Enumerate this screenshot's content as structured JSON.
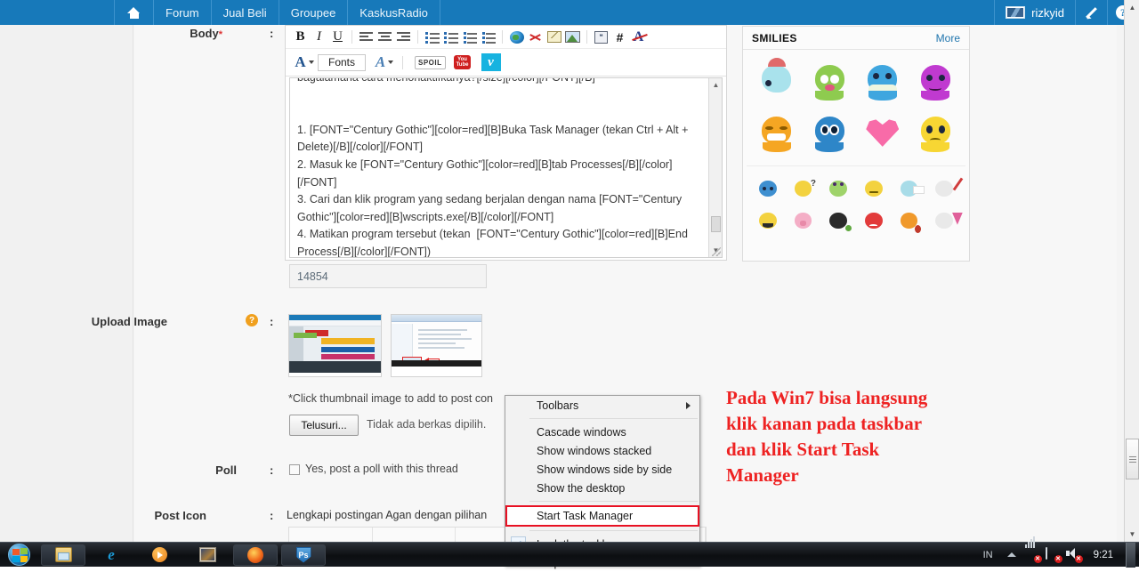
{
  "topnav": {
    "home_icon": "home-icon",
    "items": [
      {
        "label": "Forum"
      },
      {
        "label": "Jual Beli"
      },
      {
        "label": "Groupee"
      },
      {
        "label": "KaskusRadio"
      }
    ],
    "username": "rizkyid",
    "compose_icon": "pencil-icon",
    "help_icon": "question-mark-icon"
  },
  "form": {
    "body_label": "Body",
    "body_required": "*",
    "colon": ":",
    "upload_label": "Upload Image",
    "poll_label": "Poll",
    "posticon_label": "Post Icon",
    "help_badge": "?"
  },
  "editor": {
    "toolbar_row1": [
      {
        "name": "bold-icon",
        "glyph": "B"
      },
      {
        "name": "italic-icon",
        "glyph": "I"
      },
      {
        "name": "underline-icon",
        "glyph": "U"
      },
      {
        "name": "align-left-icon",
        "glyph": ""
      },
      {
        "name": "align-center-icon",
        "glyph": ""
      },
      {
        "name": "align-right-icon",
        "glyph": ""
      },
      {
        "name": "bullet-list-icon",
        "glyph": ""
      },
      {
        "name": "numbered-list-icon",
        "glyph": ""
      },
      {
        "name": "indent-icon",
        "glyph": ""
      },
      {
        "name": "outdent-icon",
        "glyph": ""
      },
      {
        "name": "insert-link-icon",
        "glyph": ""
      },
      {
        "name": "remove-link-icon",
        "glyph": ""
      },
      {
        "name": "insert-email-icon",
        "glyph": ""
      },
      {
        "name": "insert-image-icon",
        "glyph": ""
      },
      {
        "name": "quote-icon",
        "glyph": ""
      },
      {
        "name": "hash-icon",
        "glyph": "#"
      },
      {
        "name": "strike-format-icon",
        "glyph": ""
      }
    ],
    "font_color_icon": "font-color-icon",
    "fonts_label": "Fonts",
    "font_size_icon": "font-size-icon",
    "spoiler_label": "SPOIL",
    "youtube_label_top": "You",
    "youtube_label_bottom": "Tube",
    "vimeo_glyph": "v",
    "body_text": "bagaiamana cara menonaktifkanya?[/size][/color][/FONT][/B]\n\n\n1. [FONT=\"Century Gothic\"][color=red][B]Buka Task Manager (tekan Ctrl + Alt + Delete)[/B][/color][/FONT]\n2. Masuk ke [FONT=\"Century Gothic\"][color=red][B]tab Processes[/B][/color][/FONT]\n3. Cari dan klik program yang sedang berjalan dengan nama [FONT=\"Century Gothic\"][color=red][B]wscripts.exe[/B][/color][/FONT]\n4. Matikan program tersebut (tekan  [FONT=\"Century Gothic\"][color=red][B]End Process[/B][/color][/FONT])",
    "char_counter": "14854"
  },
  "upload": {
    "hint": "*Click thumbnail image to add to post con",
    "browse_button": "Telusuri...",
    "no_file_text": "Tidak ada berkas dipilih.",
    "thumbnails": [
      "forum-page-thumbnail",
      "task-manager-thumbnail"
    ]
  },
  "poll": {
    "checkbox_label": "Yes, post a poll with this thread",
    "checked": false
  },
  "posticon": {
    "text": "Lengkapi postingan Agan dengan pilihan"
  },
  "smilies": {
    "title": "SMILIES",
    "more_label": "More",
    "row1": [
      "whale-smiley",
      "green-monster-smiley",
      "blue-octopus-smiley",
      "purple-blob-smiley"
    ],
    "row2": [
      "orange-grin-smiley",
      "blue-teary-smiley",
      "pink-heart-smiley",
      "yellow-sad-smiley"
    ],
    "row3": [
      "blue-drink-smiley",
      "yellow-confused-smiley",
      "green-frog-smiley",
      "yellow-smirk-smiley",
      "blue-tissue-smiley",
      "white-pen-smiley"
    ],
    "row4": [
      "yellow-mustache-smiley",
      "pink-pig-smiley",
      "black-bomb-smiley",
      "red-angry-smiley",
      "orange-sick-smiley",
      "white-flower-smiley"
    ]
  },
  "context_menu": {
    "items": [
      {
        "label": "Toolbars",
        "submenu": true,
        "checked": false,
        "highlighted": false
      },
      {
        "label": "Cascade windows",
        "submenu": false,
        "checked": false,
        "highlighted": false
      },
      {
        "label": "Show windows stacked",
        "submenu": false,
        "checked": false,
        "highlighted": false
      },
      {
        "label": "Show windows side by side",
        "submenu": false,
        "checked": false,
        "highlighted": false
      },
      {
        "label": "Show the desktop",
        "submenu": false,
        "checked": false,
        "highlighted": false
      },
      {
        "label": "Start Task Manager",
        "submenu": false,
        "checked": false,
        "highlighted": true
      },
      {
        "label": "Lock the taskbar",
        "submenu": false,
        "checked": true,
        "highlighted": false
      },
      {
        "label": "Properties",
        "submenu": false,
        "checked": false,
        "highlighted": false
      }
    ],
    "check_glyph": "✓",
    "highlight_color": "#e81123"
  },
  "annotation": {
    "text": "Pada Win7 bisa langsung klik kanan pada taskbar dan klik Start Task Manager",
    "color": "#ee2222"
  },
  "taskbar": {
    "start_icon": "windows-start-orb",
    "buttons": [
      {
        "name": "explorer-taskbar-icon"
      },
      {
        "name": "internet-explorer-taskbar-icon"
      },
      {
        "name": "media-player-taskbar-icon"
      },
      {
        "name": "photo-taskbar-icon"
      },
      {
        "name": "firefox-taskbar-icon"
      },
      {
        "name": "photoshop-taskbar-icon"
      }
    ],
    "language": "IN",
    "clock": "9:21",
    "tray_icons": [
      "network-icon",
      "flash-drive-icon",
      "volume-muted-icon"
    ]
  }
}
